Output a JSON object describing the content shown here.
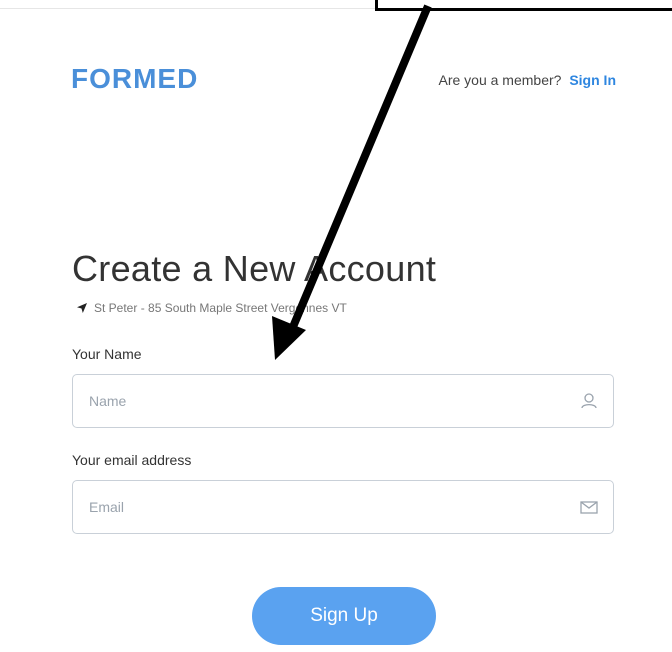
{
  "header": {
    "logo_text": "FORMED",
    "member_prompt": "Are you a member?",
    "signin_label": "Sign In"
  },
  "main": {
    "title": "Create a New Account",
    "location": "St Peter - 85 South Maple Street Vergennes VT"
  },
  "form": {
    "name_label": "Your Name",
    "name_placeholder": "Name",
    "email_label": "Your email address",
    "email_placeholder": "Email",
    "submit_label": "Sign Up"
  },
  "colors": {
    "brand": "#4a8fd9",
    "link": "#2e86e0",
    "button": "#5aa2f0"
  },
  "icons": {
    "location": "location-arrow-icon",
    "name_field": "user-icon",
    "email_field": "envelope-icon"
  }
}
